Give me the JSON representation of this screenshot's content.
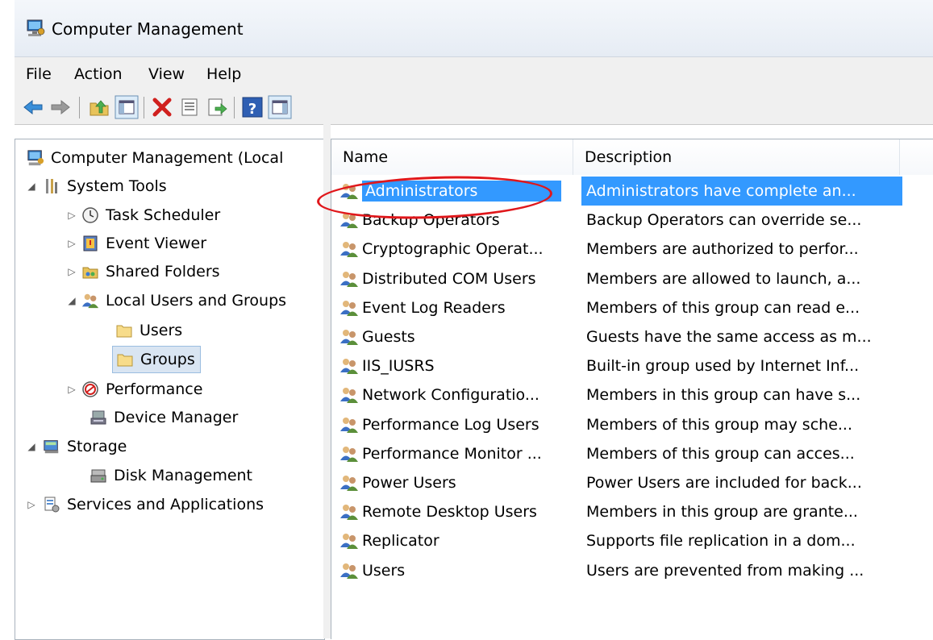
{
  "window": {
    "title": "Computer Management"
  },
  "menu": {
    "items": [
      "File",
      "Action",
      "View",
      "Help"
    ]
  },
  "toolbar": {
    "buttons": [
      "back-icon",
      "forward-icon",
      "up-folder-icon",
      "show-hide-console-tree-icon",
      "delete-icon",
      "properties-icon",
      "export-list-icon",
      "help-icon",
      "show-hide-action-pane-icon"
    ]
  },
  "tree": {
    "root": "Computer Management (Local",
    "system_tools": "System Tools",
    "task_scheduler": "Task Scheduler",
    "event_viewer": "Event Viewer",
    "shared_folders": "Shared Folders",
    "local_users_groups": "Local Users and Groups",
    "users": "Users",
    "groups": "Groups",
    "performance": "Performance",
    "device_manager": "Device Manager",
    "storage": "Storage",
    "disk_management": "Disk Management",
    "services_apps": "Services and Applications"
  },
  "list": {
    "columns": {
      "name": "Name",
      "description": "Description"
    },
    "rows": [
      {
        "name": "Administrators",
        "description": "Administrators have complete an..."
      },
      {
        "name": "Backup Operators",
        "description": "Backup Operators can override se..."
      },
      {
        "name": "Cryptographic Operat...",
        "description": "Members are authorized to perfor..."
      },
      {
        "name": "Distributed COM Users",
        "description": "Members are allowed to launch, a..."
      },
      {
        "name": "Event Log Readers",
        "description": "Members of this group can read e..."
      },
      {
        "name": "Guests",
        "description": "Guests have the same access as m..."
      },
      {
        "name": "IIS_IUSRS",
        "description": "Built-in group used by Internet Inf..."
      },
      {
        "name": "Network Configuratio...",
        "description": "Members in this group can have s..."
      },
      {
        "name": "Performance Log Users",
        "description": "Members of this group may sche..."
      },
      {
        "name": "Performance Monitor ...",
        "description": "Members of this group can acces..."
      },
      {
        "name": "Power Users",
        "description": "Power Users are included for back..."
      },
      {
        "name": "Remote Desktop Users",
        "description": "Members in this group are grante..."
      },
      {
        "name": "Replicator",
        "description": "Supports file replication in a dom..."
      },
      {
        "name": "Users",
        "description": "Users are prevented from making ..."
      }
    ]
  },
  "colors": {
    "selection": "#3399ff",
    "annotation_circle": "#e0171b"
  }
}
